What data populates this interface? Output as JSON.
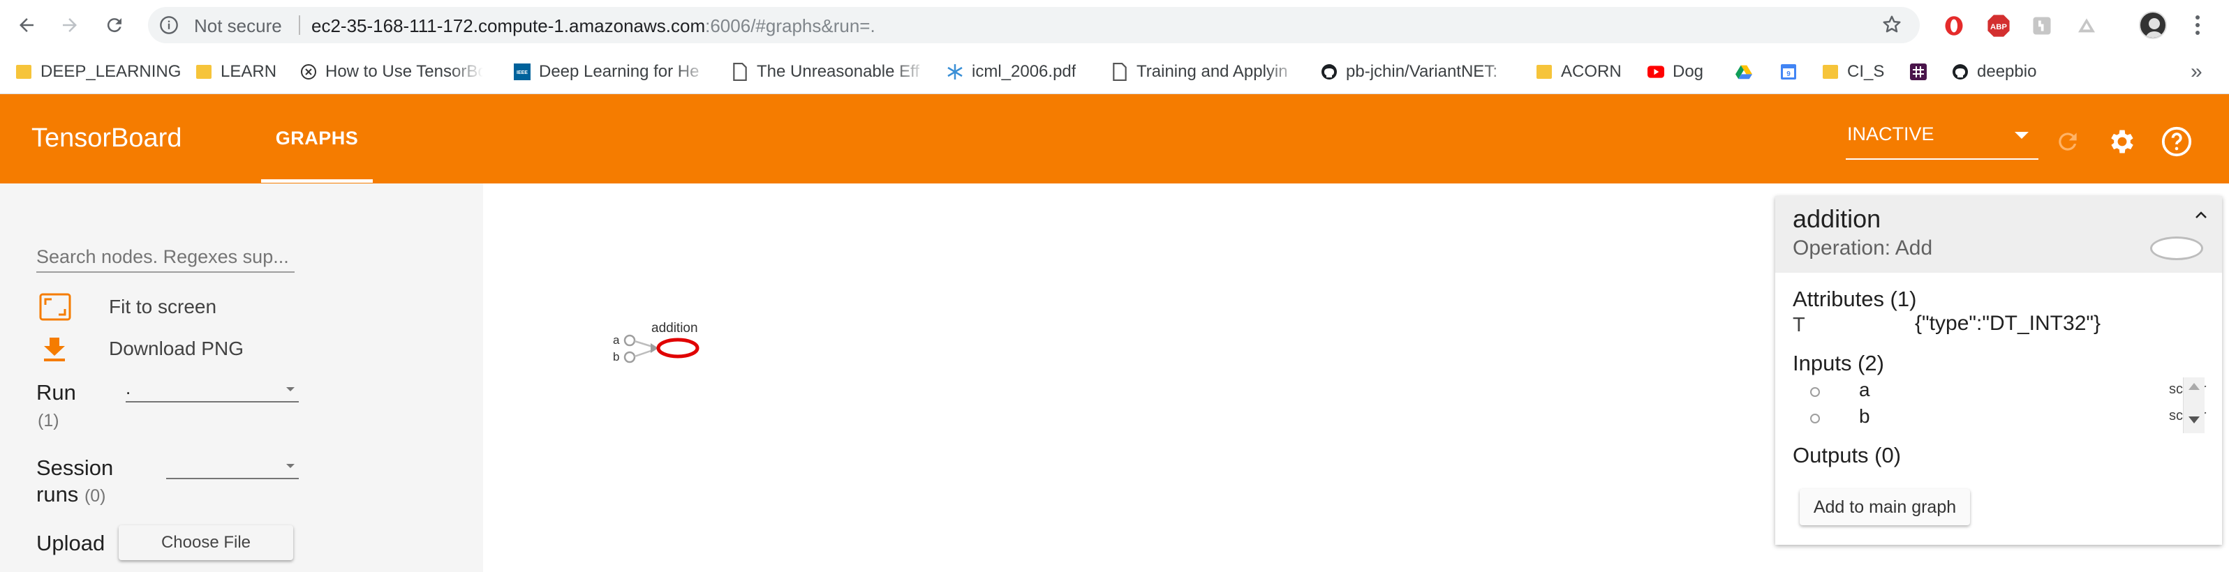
{
  "browser": {
    "back_icon": "arrow-left-icon",
    "forward_icon": "arrow-right-icon",
    "reload_icon": "reload-icon",
    "security_label": "Not secure",
    "url_host": "ec2-35-168-111-172.compute-1.amazonaws.com",
    "url_rest": ":6006/#graphs&run=.",
    "extensions": [
      "opera-icon",
      "adblock-icon",
      "extension-icon",
      "cloud-icon"
    ],
    "abp_label": "ABP",
    "bookmarks": [
      {
        "icon": "folder-icon",
        "label": "DEEP_LEARNING"
      },
      {
        "icon": "folder-icon",
        "label": "LEARN"
      },
      {
        "icon": "circle-x-icon",
        "label": "How to Use TensorBo"
      },
      {
        "icon": "ieee-icon",
        "label": "Deep Learning for He"
      },
      {
        "icon": "document-icon",
        "label": "The Unreasonable Eff"
      },
      {
        "icon": "snowflake-icon",
        "label": "icml_2006.pdf"
      },
      {
        "icon": "document-icon",
        "label": "Training and Applyin"
      },
      {
        "icon": "github-icon",
        "label": "pb-jchin/VariantNET:"
      },
      {
        "icon": "folder-icon",
        "label": "ACORN"
      },
      {
        "icon": "youtube-icon",
        "label": "Dog"
      },
      {
        "icon": "drive-icon",
        "label": ""
      },
      {
        "icon": "calendar-icon",
        "label": ""
      },
      {
        "icon": "folder-icon",
        "label": "CI_S"
      },
      {
        "icon": "slack-icon",
        "label": ""
      },
      {
        "icon": "github-icon",
        "label": "deepbio"
      }
    ],
    "calendar_day": "9",
    "ieee_label": "IEEE",
    "bookmarks_more": "»"
  },
  "tensorboard": {
    "title": "TensorBoard",
    "tab": "GRAPHS",
    "run_status": "INACTIVE",
    "accent": "#f57c00"
  },
  "sidebar": {
    "search_placeholder": "Search nodes. Regexes sup...",
    "fit_label": "Fit to screen",
    "download_label": "Download PNG",
    "run_label": "Run",
    "run_count": "(1)",
    "run_value": ".",
    "session_label_1": "Session",
    "session_label_2": "runs",
    "session_count": "(0)",
    "session_value": "",
    "upload_label": "Upload",
    "choose_file_label": "Choose File"
  },
  "graph": {
    "node_label": "addition",
    "input_a": "a",
    "input_b": "b",
    "highlight_color": "#e00000"
  },
  "info_card": {
    "title": "addition",
    "subtitle": "Operation: Add",
    "attributes_title": "Attributes (1)",
    "attr_key": "T",
    "attr_value": "{\"type\":\"DT_INT32\"}",
    "inputs_title": "Inputs (2)",
    "inputs": [
      {
        "name": "a",
        "type": "scalar"
      },
      {
        "name": "b",
        "type": "scalar"
      }
    ],
    "outputs_title": "Outputs (0)",
    "add_button": "Add to main graph"
  }
}
